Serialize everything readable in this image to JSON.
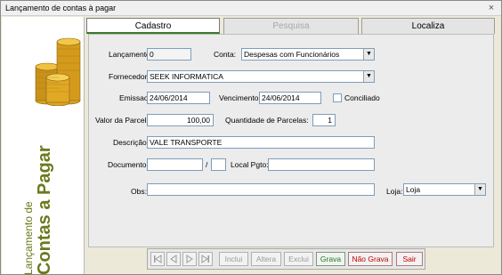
{
  "window": {
    "title": "Lançamento de contas à pagar",
    "close_glyph": "×"
  },
  "side": {
    "line1": "Lançamento de",
    "line2": "Contas a Pagar",
    "image": "gold-coins-stack"
  },
  "tabs": [
    {
      "label": "Cadastro",
      "state": "active"
    },
    {
      "label": "Pesquisa",
      "state": "disabled"
    },
    {
      "label": "Localiza",
      "state": "normal"
    }
  ],
  "form": {
    "lancamento": {
      "label": "Lançamento:",
      "value": "0"
    },
    "conta": {
      "label": "Conta:",
      "value": "Despesas com Funcionários"
    },
    "fornecedor": {
      "label": "Fornecedor:",
      "value": "SEEK INFORMATICA"
    },
    "emissao": {
      "label": "Emissao:",
      "value": "24/06/2014"
    },
    "vencimento": {
      "label": "Vencimento:",
      "value": "24/06/2014"
    },
    "conciliado": {
      "label": "Conciliado",
      "checked": false
    },
    "valor_parcela": {
      "label": "Valor da Parcela:",
      "value": "100,00"
    },
    "qtd_parcelas": {
      "label": "Quantidade de Parcelas:",
      "value": "1"
    },
    "descricao": {
      "label": "Descrição:",
      "value": "VALE TRANSPORTE"
    },
    "documento": {
      "label": "Documento:",
      "value": "",
      "separator": "/",
      "value2": ""
    },
    "local_pgto": {
      "label": "Local Pgto:",
      "value": ""
    },
    "obs": {
      "label": "Obs:",
      "value": ""
    },
    "loja": {
      "label": "Loja:",
      "value": "Loja"
    }
  },
  "nav": {
    "first": "first-record-icon",
    "prev": "previous-record-icon",
    "next": "next-record-icon",
    "last": "last-record-icon",
    "buttons": [
      {
        "label": "Inclui",
        "state": "disabled"
      },
      {
        "label": "Altera",
        "state": "disabled"
      },
      {
        "label": "Exclui",
        "state": "disabled"
      },
      {
        "label": "Grava",
        "state": "enabled"
      },
      {
        "label": "Não Grava",
        "state": "enabled"
      },
      {
        "label": "Sair",
        "state": "enabled"
      }
    ]
  },
  "colors": {
    "accent_green": "#6b7a1d",
    "save_green": "#1a7a1a",
    "cancel_red": "#c00000"
  }
}
